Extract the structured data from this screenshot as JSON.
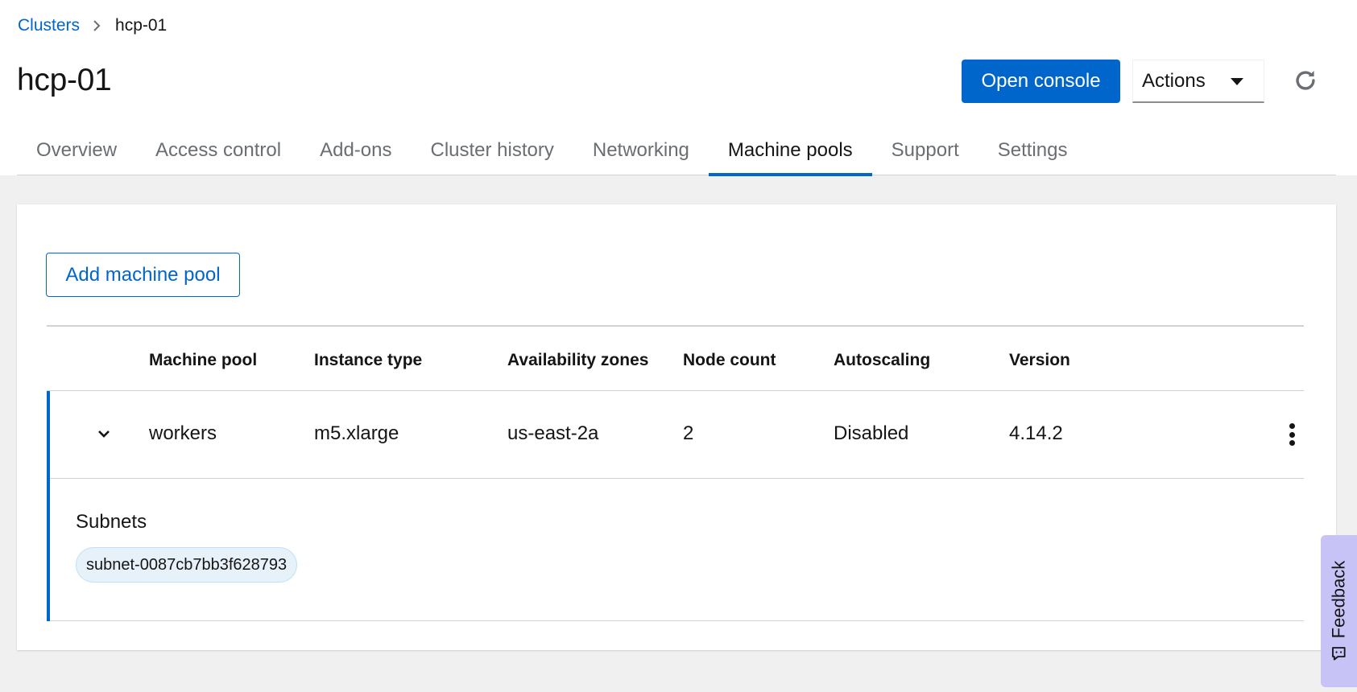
{
  "breadcrumb": {
    "parent": "Clusters",
    "current": "hcp-01"
  },
  "header": {
    "title": "hcp-01",
    "open_console": "Open console",
    "actions": "Actions"
  },
  "tabs": [
    {
      "label": "Overview",
      "active": false
    },
    {
      "label": "Access control",
      "active": false
    },
    {
      "label": "Add-ons",
      "active": false
    },
    {
      "label": "Cluster history",
      "active": false
    },
    {
      "label": "Networking",
      "active": false
    },
    {
      "label": "Machine pools",
      "active": true
    },
    {
      "label": "Support",
      "active": false
    },
    {
      "label": "Settings",
      "active": false
    }
  ],
  "machine_pools": {
    "add_button": "Add machine pool",
    "columns": [
      "Machine pool",
      "Instance type",
      "Availability zones",
      "Node count",
      "Autoscaling",
      "Version"
    ],
    "rows": [
      {
        "name": "workers",
        "instance_type": "m5.xlarge",
        "availability_zones": "us-east-2a",
        "node_count": "2",
        "autoscaling": "Disabled",
        "version": "4.14.2",
        "expanded": true,
        "subnets_label": "Subnets",
        "subnets": [
          "subnet-0087cb7bb3f628793"
        ]
      }
    ]
  },
  "feedback": {
    "label": "Feedback"
  },
  "colors": {
    "primary": "#0066cc",
    "feedback_bg": "#c8c3f7",
    "chip_bg": "#e7f1fa"
  },
  "icons": [
    "chevron-right-icon",
    "caret-down-icon",
    "refresh-icon",
    "chevron-down-icon",
    "kebab-icon",
    "feedback-icon"
  ]
}
